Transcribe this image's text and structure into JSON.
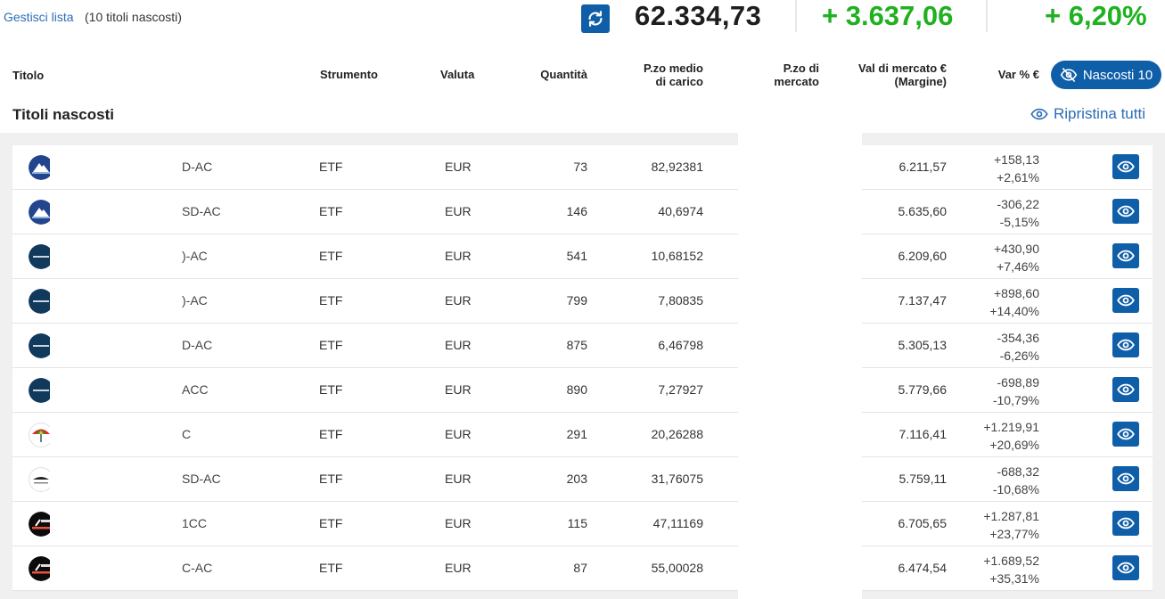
{
  "toolbar": {
    "manage_link": "Gestisci lista",
    "hidden_count": "(10 titoli nascosti)",
    "total_value": "62.334,73",
    "gain_abs": "+ 3.637,06",
    "gain_pct": "+ 6,20%",
    "accent_color": "#0f5ea8",
    "gain_color": "#1fb11f"
  },
  "header": {
    "titolo": "Titolo",
    "strumento": "Strumento",
    "valuta": "Valuta",
    "quantita": "Quantità",
    "pzo_medio_1": "P.zo medio",
    "pzo_medio_2": "di carico",
    "pzo_mercato_1": "P.zo di",
    "pzo_mercato_2": "mercato",
    "val_mercato_1": "Val di mercato €",
    "val_mercato_2": "(Margine)",
    "var": "Var % €",
    "nascosti_button": "Nascosti 10"
  },
  "section": {
    "title": "Titoli nascosti",
    "restore_all": "Ripristina tutti"
  },
  "rows": [
    {
      "name": "D-AC",
      "logo": "invesco",
      "strumento": "ETF",
      "valuta": "EUR",
      "quantita": "73",
      "pzo_medio": "82,92381",
      "val_mercato": "6.211,57",
      "var_abs": "+158,13",
      "var_pct": "+2,61%"
    },
    {
      "name": "SD-AC",
      "logo": "invesco",
      "strumento": "ETF",
      "valuta": "EUR",
      "quantita": "146",
      "pzo_medio": "40,6974",
      "val_mercato": "5.635,60",
      "var_abs": "-306,22",
      "var_pct": "-5,15%"
    },
    {
      "name": ")-AC",
      "logo": "blackrock",
      "strumento": "ETF",
      "valuta": "EUR",
      "quantita": "541",
      "pzo_medio": "10,68152",
      "val_mercato": "6.209,60",
      "var_abs": "+430,90",
      "var_pct": "+7,46%"
    },
    {
      "name": ")-AC",
      "logo": "blackrock",
      "strumento": "ETF",
      "valuta": "EUR",
      "quantita": "799",
      "pzo_medio": "7,80835",
      "val_mercato": "7.137,47",
      "var_abs": "+898,60",
      "var_pct": "+14,40%"
    },
    {
      "name": "D-AC",
      "logo": "blackrock",
      "strumento": "ETF",
      "valuta": "EUR",
      "quantita": "875",
      "pzo_medio": "6,46798",
      "val_mercato": "5.305,13",
      "var_abs": "-354,36",
      "var_pct": "-6,26%"
    },
    {
      "name": "ACC",
      "logo": "blackrock",
      "strumento": "ETF",
      "valuta": "EUR",
      "quantita": "890",
      "pzo_medio": "7,27927",
      "val_mercato": "5.779,66",
      "var_abs": "-698,89",
      "var_pct": "-10,79%"
    },
    {
      "name": "C",
      "logo": "umbrella",
      "strumento": "ETF",
      "valuta": "EUR",
      "quantita": "291",
      "pzo_medio": "20,26288",
      "val_mercato": "7.116,41",
      "var_abs": "+1.219,91",
      "var_pct": "+20,69%"
    },
    {
      "name": "SD-AC",
      "logo": "wisdomtree",
      "strumento": "ETF",
      "valuta": "EUR",
      "quantita": "203",
      "pzo_medio": "31,76075",
      "val_mercato": "5.759,11",
      "var_abs": "-688,32",
      "var_pct": "-10,68%"
    },
    {
      "name": "1CC",
      "logo": "dws",
      "strumento": "ETF",
      "valuta": "EUR",
      "quantita": "115",
      "pzo_medio": "47,11169",
      "val_mercato": "6.705,65",
      "var_abs": "+1.287,81",
      "var_pct": "+23,77%"
    },
    {
      "name": "C-AC",
      "logo": "dws",
      "strumento": "ETF",
      "valuta": "EUR",
      "quantita": "87",
      "pzo_medio": "55,00028",
      "val_mercato": "6.474,54",
      "var_abs": "+1.689,52",
      "var_pct": "+35,31%"
    }
  ]
}
